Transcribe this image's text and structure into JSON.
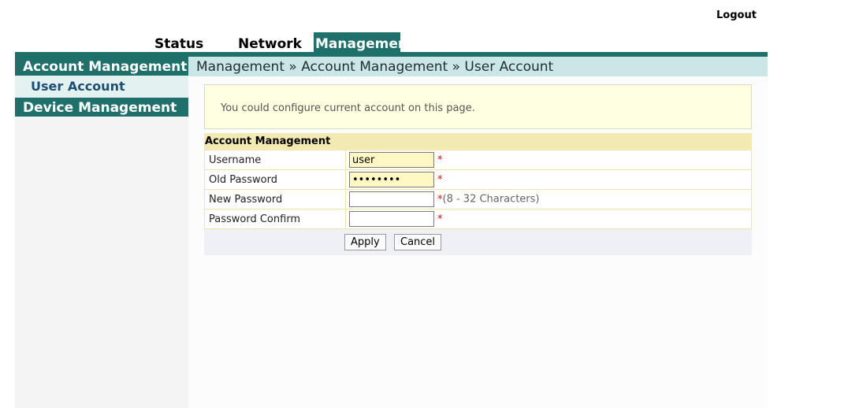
{
  "header": {
    "logout_label": "Logout"
  },
  "nav": {
    "tabs": [
      {
        "label": "Status"
      },
      {
        "label": "Network"
      },
      {
        "label": "Management",
        "active": true
      }
    ],
    "active_color": "#1f6f6b"
  },
  "sidebar": {
    "sections": [
      {
        "label": "Account Management",
        "items": [
          {
            "label": "User Account",
            "selected": true
          }
        ]
      },
      {
        "label": "Device Management",
        "items": []
      }
    ]
  },
  "main": {
    "breadcrumb": "Management » Account Management » User Account",
    "info_text": "You could configure current account on this page.",
    "form": {
      "title": "Account Management",
      "rows": [
        {
          "label": "Username",
          "value": "user",
          "type": "text"
        },
        {
          "label": "Old Password",
          "value": "••••••••",
          "type": "password"
        },
        {
          "label": "New Password",
          "value": "",
          "type": "password",
          "hint": "(8 - 32 Characters)"
        },
        {
          "label": "Password Confirm",
          "value": "",
          "type": "password"
        }
      ],
      "required_mark": "*",
      "apply_label": "Apply",
      "cancel_label": "Cancel"
    }
  }
}
